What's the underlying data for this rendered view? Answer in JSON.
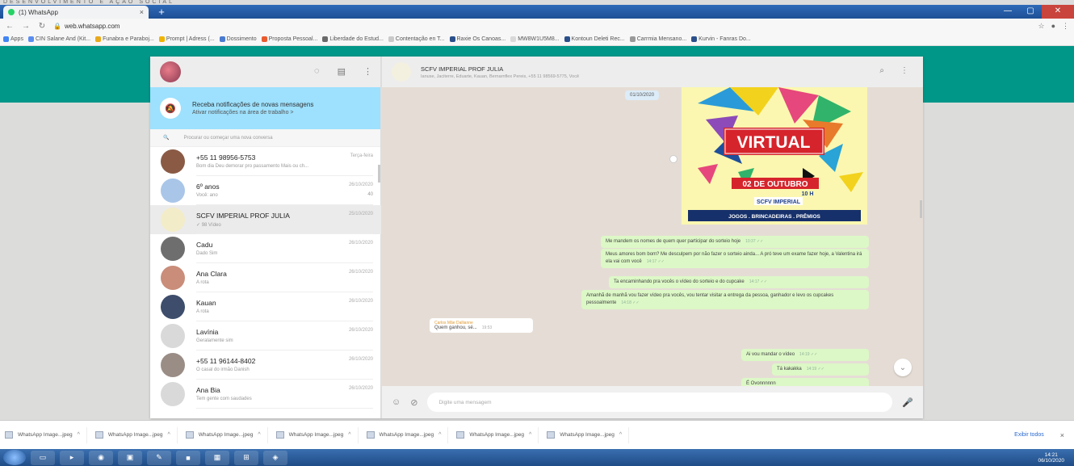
{
  "browser": {
    "banner": "DESENVOLVIMENTO E AÇÃO SOCIAL",
    "tab_title": "(1) WhatsApp",
    "tab_close": "×",
    "newtab": "+",
    "url": "web.whatsapp.com",
    "bookmarks": [
      {
        "label": "Apps",
        "color": "#4285f4"
      },
      {
        "label": "CIN Salane And (Kit...",
        "color": "#5b8def"
      },
      {
        "label": "Funabra e Paraboj...",
        "color": "#e8a91b"
      },
      {
        "label": "Prompt | Adress (...",
        "color": "#f0b400"
      },
      {
        "label": "Dossimento",
        "color": "#4a7bd0"
      },
      {
        "label": "Proposta Pessoal...",
        "color": "#e95b2f"
      },
      {
        "label": "Liberdade do Estud...",
        "color": "#6a6a6a"
      },
      {
        "label": "Contentação en T...",
        "color": "#c9c9c9"
      },
      {
        "label": "Raxie Os Canoas...",
        "color": "#2b4f8a"
      },
      {
        "label": "MW8W1U5M8...",
        "color": "#d9d9d9"
      },
      {
        "label": "Kontoun Deleti Rec...",
        "color": "#2b4f8a"
      },
      {
        "label": "Carrmia Mensano...",
        "color": "#999"
      },
      {
        "label": "Kurvin - Fanras Do...",
        "color": "#2b4f8a"
      }
    ]
  },
  "sidebar": {
    "notification": {
      "title": "Receba notificações de novas mensagens",
      "subtitle": "Ativar notificações na área de trabalho >"
    },
    "search_placeholder": "Procurar ou começar uma nova conversa",
    "chats": [
      {
        "name": "+55 11 98956-5753",
        "last": "Bom dia Deu demorar pro passamento Mais ou ch...",
        "time": "Terça-feira",
        "badge": "",
        "avatar": "#8a5a45",
        "active": false
      },
      {
        "name": "6º anos",
        "last": "Você: ano",
        "time": "26/10/2020",
        "badge": "40",
        "avatar": "#a9c6e8",
        "active": false
      },
      {
        "name": "SCFV IMPERIAL PROF JULIA",
        "last": "✓ 98 Vídeo",
        "time": "25/10/2020",
        "badge": "",
        "avatar": "#f3ecc8",
        "active": true
      },
      {
        "name": "Cadu",
        "last": "Dado Sim",
        "time": "26/10/2020",
        "badge": "",
        "avatar": "#6e6e6e",
        "active": false
      },
      {
        "name": "Ana Clara",
        "last": "A rota",
        "time": "26/10/2020",
        "badge": "",
        "avatar": "#c98d7a",
        "active": false
      },
      {
        "name": "Kauan",
        "last": "A rota",
        "time": "26/10/2020",
        "badge": "",
        "avatar": "#3d4d6b",
        "active": false
      },
      {
        "name": "Lavínia",
        "last": "Geralamente sim",
        "time": "26/10/2020",
        "badge": "",
        "avatar": "#d9d9d9",
        "active": false
      },
      {
        "name": "+55 11 96144-8402",
        "last": "O casal do irmão Danish",
        "time": "26/10/2020",
        "badge": "",
        "avatar": "#9a8d86",
        "active": false
      },
      {
        "name": "Ana Bia",
        "last": "Tem gente com saudades",
        "time": "26/10/2020",
        "badge": "",
        "avatar": "#d9d9d9",
        "active": false
      }
    ]
  },
  "conversation": {
    "title": "SCFV IMPERIAL PROF JULIA",
    "subtitle": "Ianuse, Jaciterre, Eduarte, Kauan, Bernarnflex Pereis, +55 11 98569-5775, Você",
    "date_chip": "01/10/2020",
    "poster": {
      "headline": "VIRTUAL",
      "date": "02 DE OUTUBRO",
      "time": "10 H",
      "org": "SCFV IMPERIAL",
      "footer": "JOGOS . BRINCADEIRAS . PRÊMIOS"
    },
    "outgoing": [
      {
        "text": "Me mandem os nomes de quem quer participar do sorteio hoje",
        "meta": "10:37 ✓✓"
      },
      {
        "text": "Meus amores bom bom? Me desculpem por não fazer o sorteio ainda... A pró teve um exame fazer hoje, a Valentina irá ela vai com você",
        "meta": "14:17 ✓✓"
      },
      {
        "text": "Ta encaminhando pra vocês o vídeo do sorteio e do cupcake",
        "meta": "14:17 ✓✓"
      },
      {
        "text": "Amanhã de manhã vou fazer vídeo pra vocês, vou tentar visitar a entrega da pessoa, ganhador e levo os cupcakes pessoalmente",
        "meta": "14:18 ✓✓"
      },
      {
        "text": "Ai vou mandar o vídeo",
        "meta": "14:19 ✓✓"
      },
      {
        "text": "Tá kakakka",
        "meta": "14:19 ✓✓"
      },
      {
        "text": "É Ovonnnnnn",
        "meta": ""
      }
    ],
    "incoming": {
      "sender": "Carlos Mãe Dallianne",
      "text": "Quem ganhou, sé...",
      "meta": "19:53"
    },
    "composer_placeholder": "Digite uma mensagem"
  },
  "downloads": {
    "items": [
      "WhatsApp Image...jpeg",
      "WhatsApp Image...jpeg",
      "WhatsApp Image...jpeg",
      "WhatsApp Image...jpeg",
      "WhatsApp Image...jpeg",
      "WhatsApp Image...jpeg",
      "WhatsApp Image...jpeg"
    ],
    "show_all": "Exibir todos",
    "close": "×"
  },
  "taskbar": {
    "clock_time": "14:21",
    "clock_date": "06/10/2020"
  },
  "colors": {
    "teal": "#009688",
    "outgoing_bubble": "#dcf8c6",
    "notification_bg": "#9de1fe",
    "chat_bg": "#e5ddd5"
  }
}
